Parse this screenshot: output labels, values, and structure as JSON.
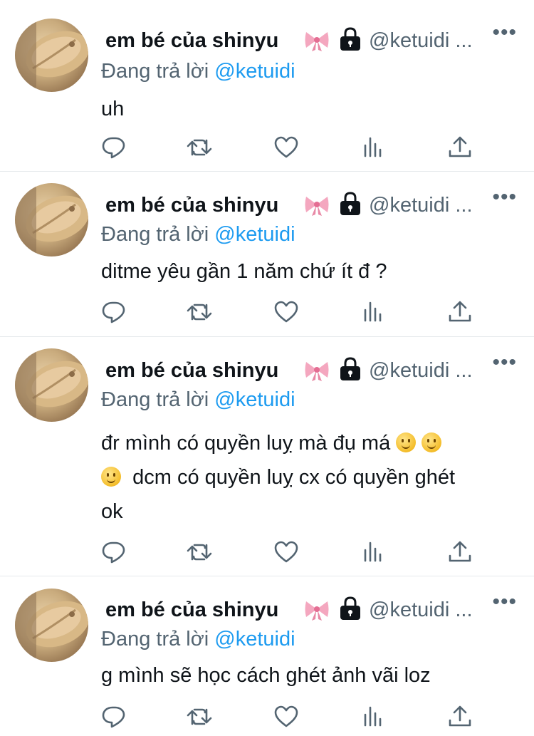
{
  "colors": {
    "accent": "#1d9bf0",
    "muted": "#536471",
    "text": "#0f1419",
    "divider": "#e6e9ec"
  },
  "tweets": [
    {
      "author_name": "em bé của shinyu",
      "handle": "@ketuidi ...",
      "more": "•••",
      "reply_prefix": "Đang trả lời",
      "reply_to": "@ketuidi",
      "lines": [
        "uh"
      ],
      "icons": [
        "bow-emoji",
        "lock-icon"
      ]
    },
    {
      "author_name": "em bé của shinyu",
      "handle": "@ketuidi ...",
      "more": "•••",
      "reply_prefix": "Đang trả lời",
      "reply_to": "@ketuidi",
      "lines": [
        "ditme yêu gần 1 năm chứ ít đ ?"
      ],
      "icons": [
        "bow-emoji",
        "lock-icon"
      ]
    },
    {
      "author_name": "em bé của shinyu",
      "handle": "@ketuidi ...",
      "more": "•••",
      "reply_prefix": "Đang trả lời",
      "reply_to": "@ketuidi",
      "lines": [
        "đr mình có quyền luỵ mà đụ má",
        "dcm có quyền luỵ cx có quyền ghét",
        "ok"
      ],
      "icons": [
        "bow-emoji",
        "lock-icon",
        "slightly-smiling-face-emoji"
      ]
    },
    {
      "author_name": "em bé của shinyu",
      "handle": "@ketuidi ...",
      "more": "•••",
      "reply_prefix": "Đang trả lời",
      "reply_to": "@ketuidi",
      "lines": [
        "g mình sẽ học cách ghét ảnh vãi loz"
      ],
      "icons": [
        "bow-emoji",
        "lock-icon"
      ]
    }
  ],
  "action_icons": [
    "reply-icon",
    "retweet-icon",
    "like-icon",
    "analytics-icon",
    "share-icon"
  ]
}
